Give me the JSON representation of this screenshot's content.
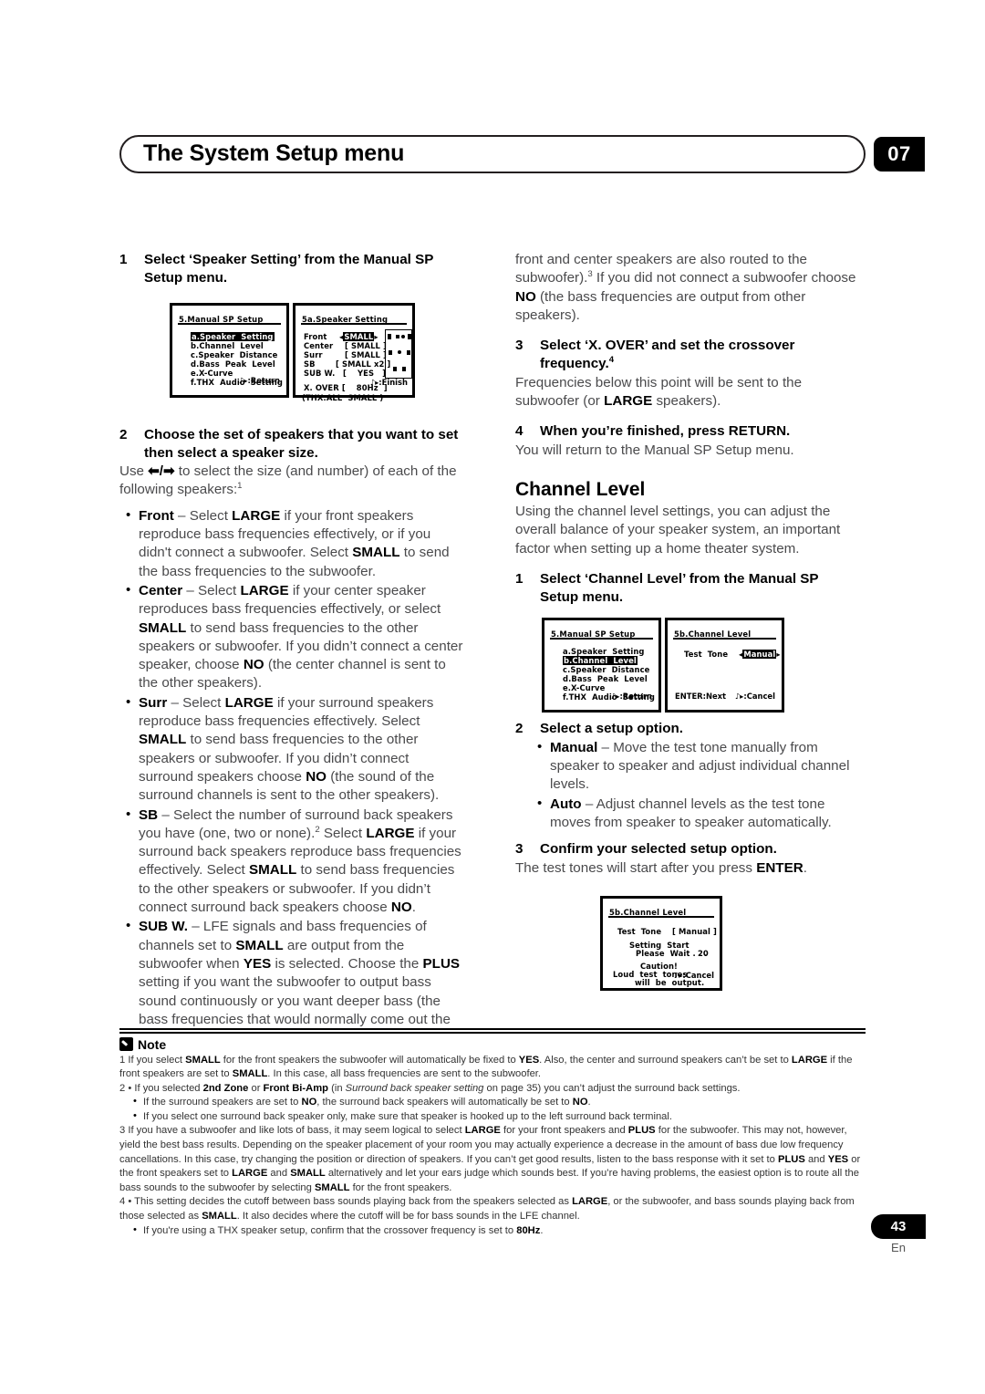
{
  "header": {
    "title": "The System Setup menu",
    "chapter": "07"
  },
  "footer": {
    "page": "43",
    "lang": "En"
  },
  "left_column": {
    "step1": {
      "num": "1",
      "text": "Select ‘Speaker Setting’ from the Manual SP Setup menu."
    },
    "step2": {
      "num": "2",
      "text": "Choose the set of speakers that you want to set then select a speaker size."
    },
    "step2_body_a": "Use ",
    "step2_arrows": "⬅/➡",
    "step2_body_b": " to select the size (and number) of each of the",
    "step2_body_c": "following speakers:",
    "step2_body_c_sup": "1",
    "bullets": [
      {
        "term": "Front",
        "body_parts": [
          {
            "t": " – Select ",
            "b": false
          },
          {
            "t": "LARGE",
            "b": true
          },
          {
            "t": " if your front speakers reproduce bass frequencies effectively, or if you didn't connect a subwoofer. Select ",
            "b": false
          },
          {
            "t": "SMALL",
            "b": true
          },
          {
            "t": " to send the bass frequencies to the subwoofer.",
            "b": false
          }
        ]
      },
      {
        "term": "Center",
        "body_parts": [
          {
            "t": " – Select ",
            "b": false
          },
          {
            "t": "LARGE",
            "b": true
          },
          {
            "t": " if your center speaker reproduces bass frequencies effectively, or select ",
            "b": false
          },
          {
            "t": "SMALL",
            "b": true
          },
          {
            "t": " to send bass frequencies to the other speakers or subwoofer. If you didn’t connect a center speaker, choose ",
            "b": false
          },
          {
            "t": "NO",
            "b": true
          },
          {
            "t": " (the center channel is sent to the other speakers).",
            "b": false
          }
        ]
      },
      {
        "term": "Surr",
        "body_parts": [
          {
            "t": " – Select ",
            "b": false
          },
          {
            "t": "LARGE",
            "b": true
          },
          {
            "t": " if your surround speakers reproduce bass frequencies effectively. Select ",
            "b": false
          },
          {
            "t": "SMALL",
            "b": true
          },
          {
            "t": " to send bass frequencies to the other speakers or subwoofer. If you didn’t connect surround speakers choose ",
            "b": false
          },
          {
            "t": "NO",
            "b": true
          },
          {
            "t": " (the sound of the surround channels is sent to the other speakers).",
            "b": false
          }
        ]
      },
      {
        "term": "SB",
        "body_parts": [
          {
            "t": " – Select the number of surround back speakers you have (one, two or none).",
            "b": false
          },
          {
            "t": "2",
            "sup": true
          },
          {
            "t": " Select ",
            "b": false
          },
          {
            "t": "LARGE",
            "b": true
          },
          {
            "t": " if your surround back speakers reproduce bass frequencies effectively. Select ",
            "b": false
          },
          {
            "t": "SMALL",
            "b": true
          },
          {
            "t": " to send bass frequencies to the other speakers or subwoofer. If you didn’t connect surround back speakers choose ",
            "b": false
          },
          {
            "t": "NO",
            "b": true
          },
          {
            "t": ".",
            "b": false
          }
        ]
      },
      {
        "term": "SUB W.",
        "body_parts": [
          {
            "t": " – LFE signals and bass frequencies of channels set to ",
            "b": false
          },
          {
            "t": "SMALL",
            "b": true
          },
          {
            "t": " are output from the subwoofer when ",
            "b": false
          },
          {
            "t": "YES",
            "b": true
          },
          {
            "t": " is selected. Choose the ",
            "b": false
          },
          {
            "t": "PLUS",
            "b": true
          },
          {
            "t": " setting if you want the subwoofer to output bass sound continuously or you want deeper bass (the bass frequencies that would normally come out the",
            "b": false
          }
        ]
      }
    ]
  },
  "right_column": {
    "continuation": [
      {
        "t": "front and center speakers are also routed to the subwoofer).",
        "b": false
      },
      {
        "t": "3",
        "sup": true
      },
      {
        "t": " If you did not connect a subwoofer choose ",
        "b": false
      },
      {
        "t": "NO",
        "b": true
      },
      {
        "t": " (the bass frequencies are output from other speakers).",
        "b": false
      }
    ],
    "step3": {
      "num": "3",
      "text": "Select ‘X. OVER’ and set the crossover frequency.",
      "sup": "4"
    },
    "step3_body": [
      {
        "t": "Frequencies below this point will be sent to the subwoofer (or ",
        "b": false
      },
      {
        "t": "LARGE",
        "b": true
      },
      {
        "t": " speakers).",
        "b": false
      }
    ],
    "step4": {
      "num": "4",
      "text": "When you’re finished, press RETURN."
    },
    "step4_body": "You will return to the Manual SP Setup menu.",
    "section_heading": "Channel Level",
    "section_body": "Using the channel level settings, you can adjust the overall balance of your speaker system, an important factor when setting up a home theater system.",
    "cl_step1": {
      "num": "1",
      "text": "Select ‘Channel Level’ from the Manual SP Setup menu."
    },
    "cl_step2": {
      "num": "2",
      "text": "Select a setup option."
    },
    "cl_bullets": [
      {
        "term": "Manual",
        "body": " – Move the test tone manually from speaker to speaker and adjust individual channel levels."
      },
      {
        "term": "Auto",
        "body": " – Adjust channel levels as the test tone moves from speaker to speaker automatically."
      }
    ],
    "cl_step3": {
      "num": "3",
      "text": "Confirm your selected setup option."
    },
    "cl_step3_body": [
      {
        "t": "The test tones will start after you press ",
        "b": false
      },
      {
        "t": "ENTER",
        "b": true
      },
      {
        "t": ".",
        "b": false
      }
    ]
  },
  "osd_screens": {
    "manual_sp_setup_a": {
      "title": "5.Manual  SP  Setup",
      "items": [
        "a.Speaker  Setting",
        "b.Channel  Level",
        "c.Speaker  Distance",
        "d.Bass  Peak  Level",
        "e.X-Curve",
        "f.THX  Audio  Setting"
      ],
      "selected_index": 0,
      "footer": "♪▸:Return"
    },
    "speaker_setting": {
      "title": "5a.Speaker  Setting",
      "rows": [
        {
          "label": "Front",
          "value": "SMALL",
          "highlighted": true
        },
        {
          "label": "Center",
          "value": "[ SMALL ]",
          "highlighted": false
        },
        {
          "label": "Surr",
          "value": "[ SMALL ]",
          "highlighted": false
        },
        {
          "label": "SB",
          "value": "[ SMALL x2 ]",
          "highlighted": false
        },
        {
          "label": "SUB W.",
          "value": "[    YES   ]",
          "highlighted": false
        }
      ],
      "xover": "X. OVER [    80Hz  ]",
      "thx_note": "(THX:ALL  SMALL )",
      "footer": "♪▸:Finish"
    },
    "manual_sp_setup_b": {
      "title": "5.Manual  SP  Setup",
      "items": [
        "a.Speaker  Setting",
        "b.Channel  Level",
        "c.Speaker  Distance",
        "d.Bass  Peak  Level",
        "e.X-Curve",
        "f.THX  Audio  Setting"
      ],
      "selected_index": 1,
      "footer": "♪▸:Return"
    },
    "channel_level": {
      "title": "5b.Channel  Level",
      "row_label": "Test  Tone",
      "row_value": "Manual",
      "footer_left": "ENTER:Next",
      "footer_right": "♪▸:Cancel"
    },
    "channel_level_wait": {
      "title": "5b.Channel  Level",
      "row_label": "Test  Tone",
      "row_value": "[ Manual ]",
      "line1": "Setting  Start",
      "line2": "Please  Wait . . .",
      "counter": "20",
      "line3": "Caution!",
      "line4": "Loud  test  tones",
      "line5": "will  be  output.",
      "footer": "♪▸:Cancel"
    }
  },
  "notes": {
    "title": "Note",
    "items": [
      {
        "kind": "numbered",
        "num": "1",
        "parts": [
          {
            "t": "If you select ",
            "b": false
          },
          {
            "t": "SMALL",
            "b": true
          },
          {
            "t": " for the front speakers the subwoofer will automatically be fixed to ",
            "b": false
          },
          {
            "t": "YES",
            "b": true
          },
          {
            "t": ". Also, the center and surround speakers can’t be set to ",
            "b": false
          },
          {
            "t": "LARGE",
            "b": true
          },
          {
            "t": " if the front speakers are set to ",
            "b": false
          },
          {
            "t": "SMALL",
            "b": true
          },
          {
            "t": ". In this case, all bass frequencies are sent to the subwoofer.",
            "b": false
          }
        ]
      },
      {
        "kind": "numbered-bullet",
        "num": "2",
        "parts": [
          {
            "t": "If you selected ",
            "b": false
          },
          {
            "t": "2nd Zone",
            "b": true
          },
          {
            "t": " or ",
            "b": false
          },
          {
            "t": "Front Bi-Amp",
            "b": true
          },
          {
            "t": " (in ",
            "b": false
          },
          {
            "t": "Surround back speaker setting",
            "i": true
          },
          {
            "t": " on page 35) you can’t adjust the surround back settings.",
            "b": false
          }
        ]
      },
      {
        "kind": "sub-bullet",
        "parts": [
          {
            "t": "If the surround speakers are set to ",
            "b": false
          },
          {
            "t": "NO",
            "b": true
          },
          {
            "t": ", the surround back speakers will automatically be set to ",
            "b": false
          },
          {
            "t": "NO",
            "b": true
          },
          {
            "t": ".",
            "b": false
          }
        ]
      },
      {
        "kind": "sub-bullet",
        "parts": [
          {
            "t": "If you select one surround back speaker only, make sure that speaker is hooked up to the left surround back terminal.",
            "b": false
          }
        ]
      },
      {
        "kind": "numbered",
        "num": "3",
        "parts": [
          {
            "t": "If you have a subwoofer and like lots of bass, it may seem logical to select ",
            "b": false
          },
          {
            "t": "LARGE",
            "b": true
          },
          {
            "t": " for your front speakers and ",
            "b": false
          },
          {
            "t": "PLUS",
            "b": true
          },
          {
            "t": " for the subwoofer. This may not, however, yield the best bass results. Depending on the speaker placement of your room you may actually experience a decrease in the amount of bass due low frequency cancellations. In this case, try changing the position or direction of speakers. If you can’t get good results, listen to the bass response with it set to ",
            "b": false
          },
          {
            "t": "PLUS",
            "b": true
          },
          {
            "t": " and ",
            "b": false
          },
          {
            "t": "YES",
            "b": true
          },
          {
            "t": " or the front speakers set to ",
            "b": false
          },
          {
            "t": "LARGE",
            "b": true
          },
          {
            "t": " and ",
            "b": false
          },
          {
            "t": "SMALL",
            "b": true
          },
          {
            "t": " alternatively and let your ears judge which sounds best. If you’re having problems, the easiest option is to route all the bass sounds to the subwoofer by selecting ",
            "b": false
          },
          {
            "t": "SMALL",
            "b": true
          },
          {
            "t": " for the front speakers.",
            "b": false
          }
        ]
      },
      {
        "kind": "numbered-bullet",
        "num": "4",
        "parts": [
          {
            "t": "This setting decides the cutoff between bass sounds playing back from the speakers selected as ",
            "b": false
          },
          {
            "t": "LARGE",
            "b": true
          },
          {
            "t": ", or the subwoofer, and bass sounds playing back from those selected as ",
            "b": false
          },
          {
            "t": "SMALL",
            "b": true
          },
          {
            "t": ". It also decides where the cutoff will be for bass sounds in the LFE channel.",
            "b": false
          }
        ]
      },
      {
        "kind": "sub-bullet",
        "parts": [
          {
            "t": "If you're using a THX speaker setup, confirm that the crossover frequency is set to ",
            "b": false
          },
          {
            "t": "80Hz",
            "b": true
          },
          {
            "t": ".",
            "b": false
          }
        ]
      }
    ]
  }
}
